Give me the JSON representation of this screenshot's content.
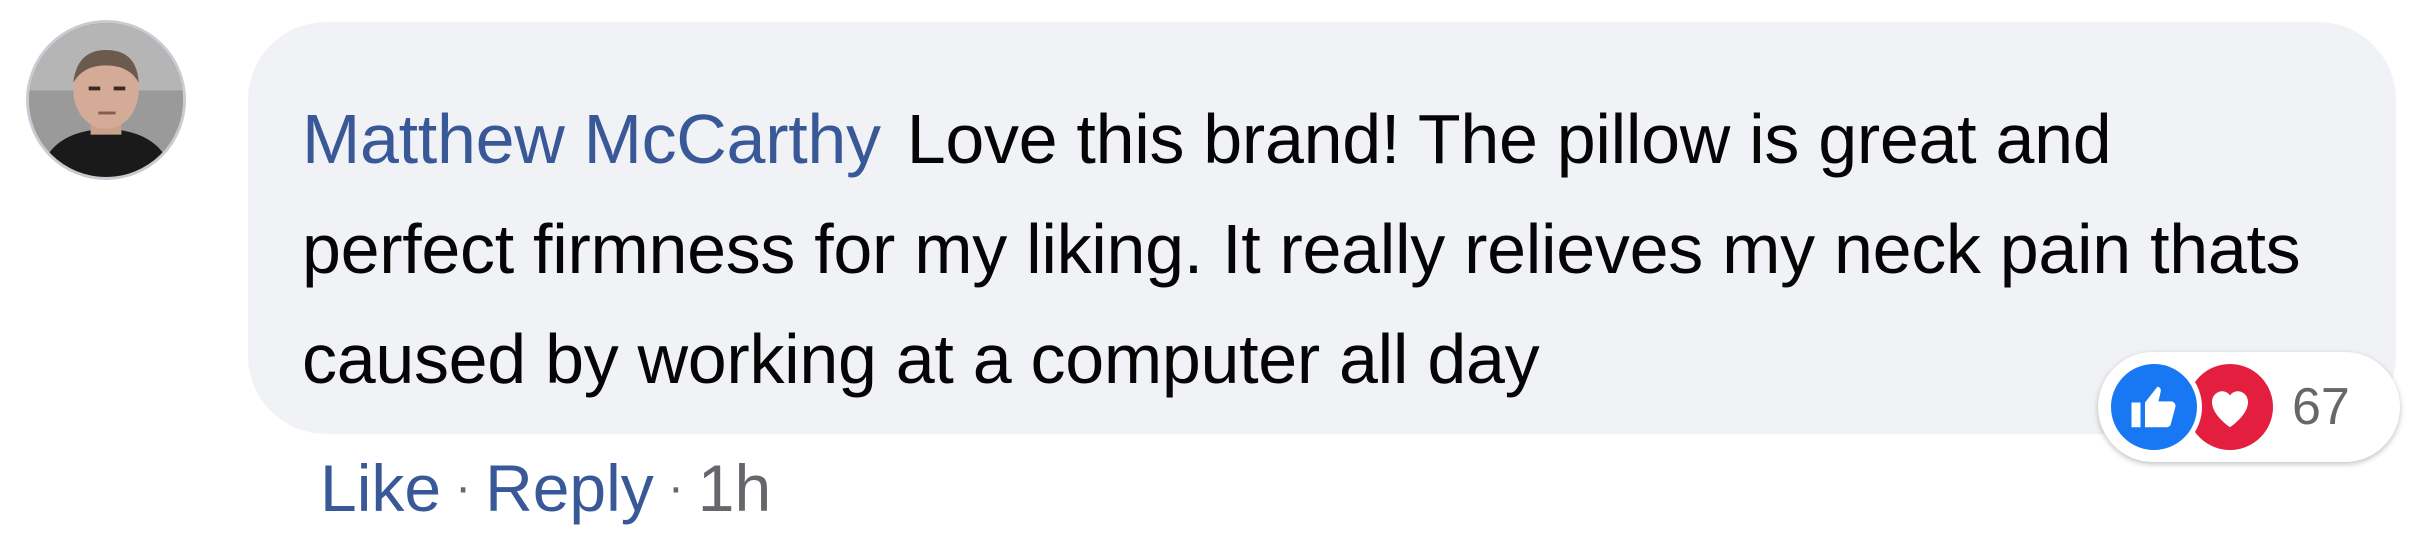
{
  "comment": {
    "author": "Matthew McCarthy",
    "text": "Love this brand! The pillow is great and perfect firmness for my liking. It really relieves my neck pain thats caused by working at a computer all day"
  },
  "reactions": {
    "icons": [
      "like-icon",
      "love-icon"
    ],
    "count": "67"
  },
  "actions": {
    "like_label": "Like",
    "reply_label": "Reply",
    "separator": "·",
    "timestamp": "1h"
  },
  "colors": {
    "link_blue": "#385898",
    "bubble_bg": "#f0f2f5",
    "like_blue": "#1877f2",
    "love_red": "#e41e3f",
    "meta_gray": "#65676b"
  }
}
